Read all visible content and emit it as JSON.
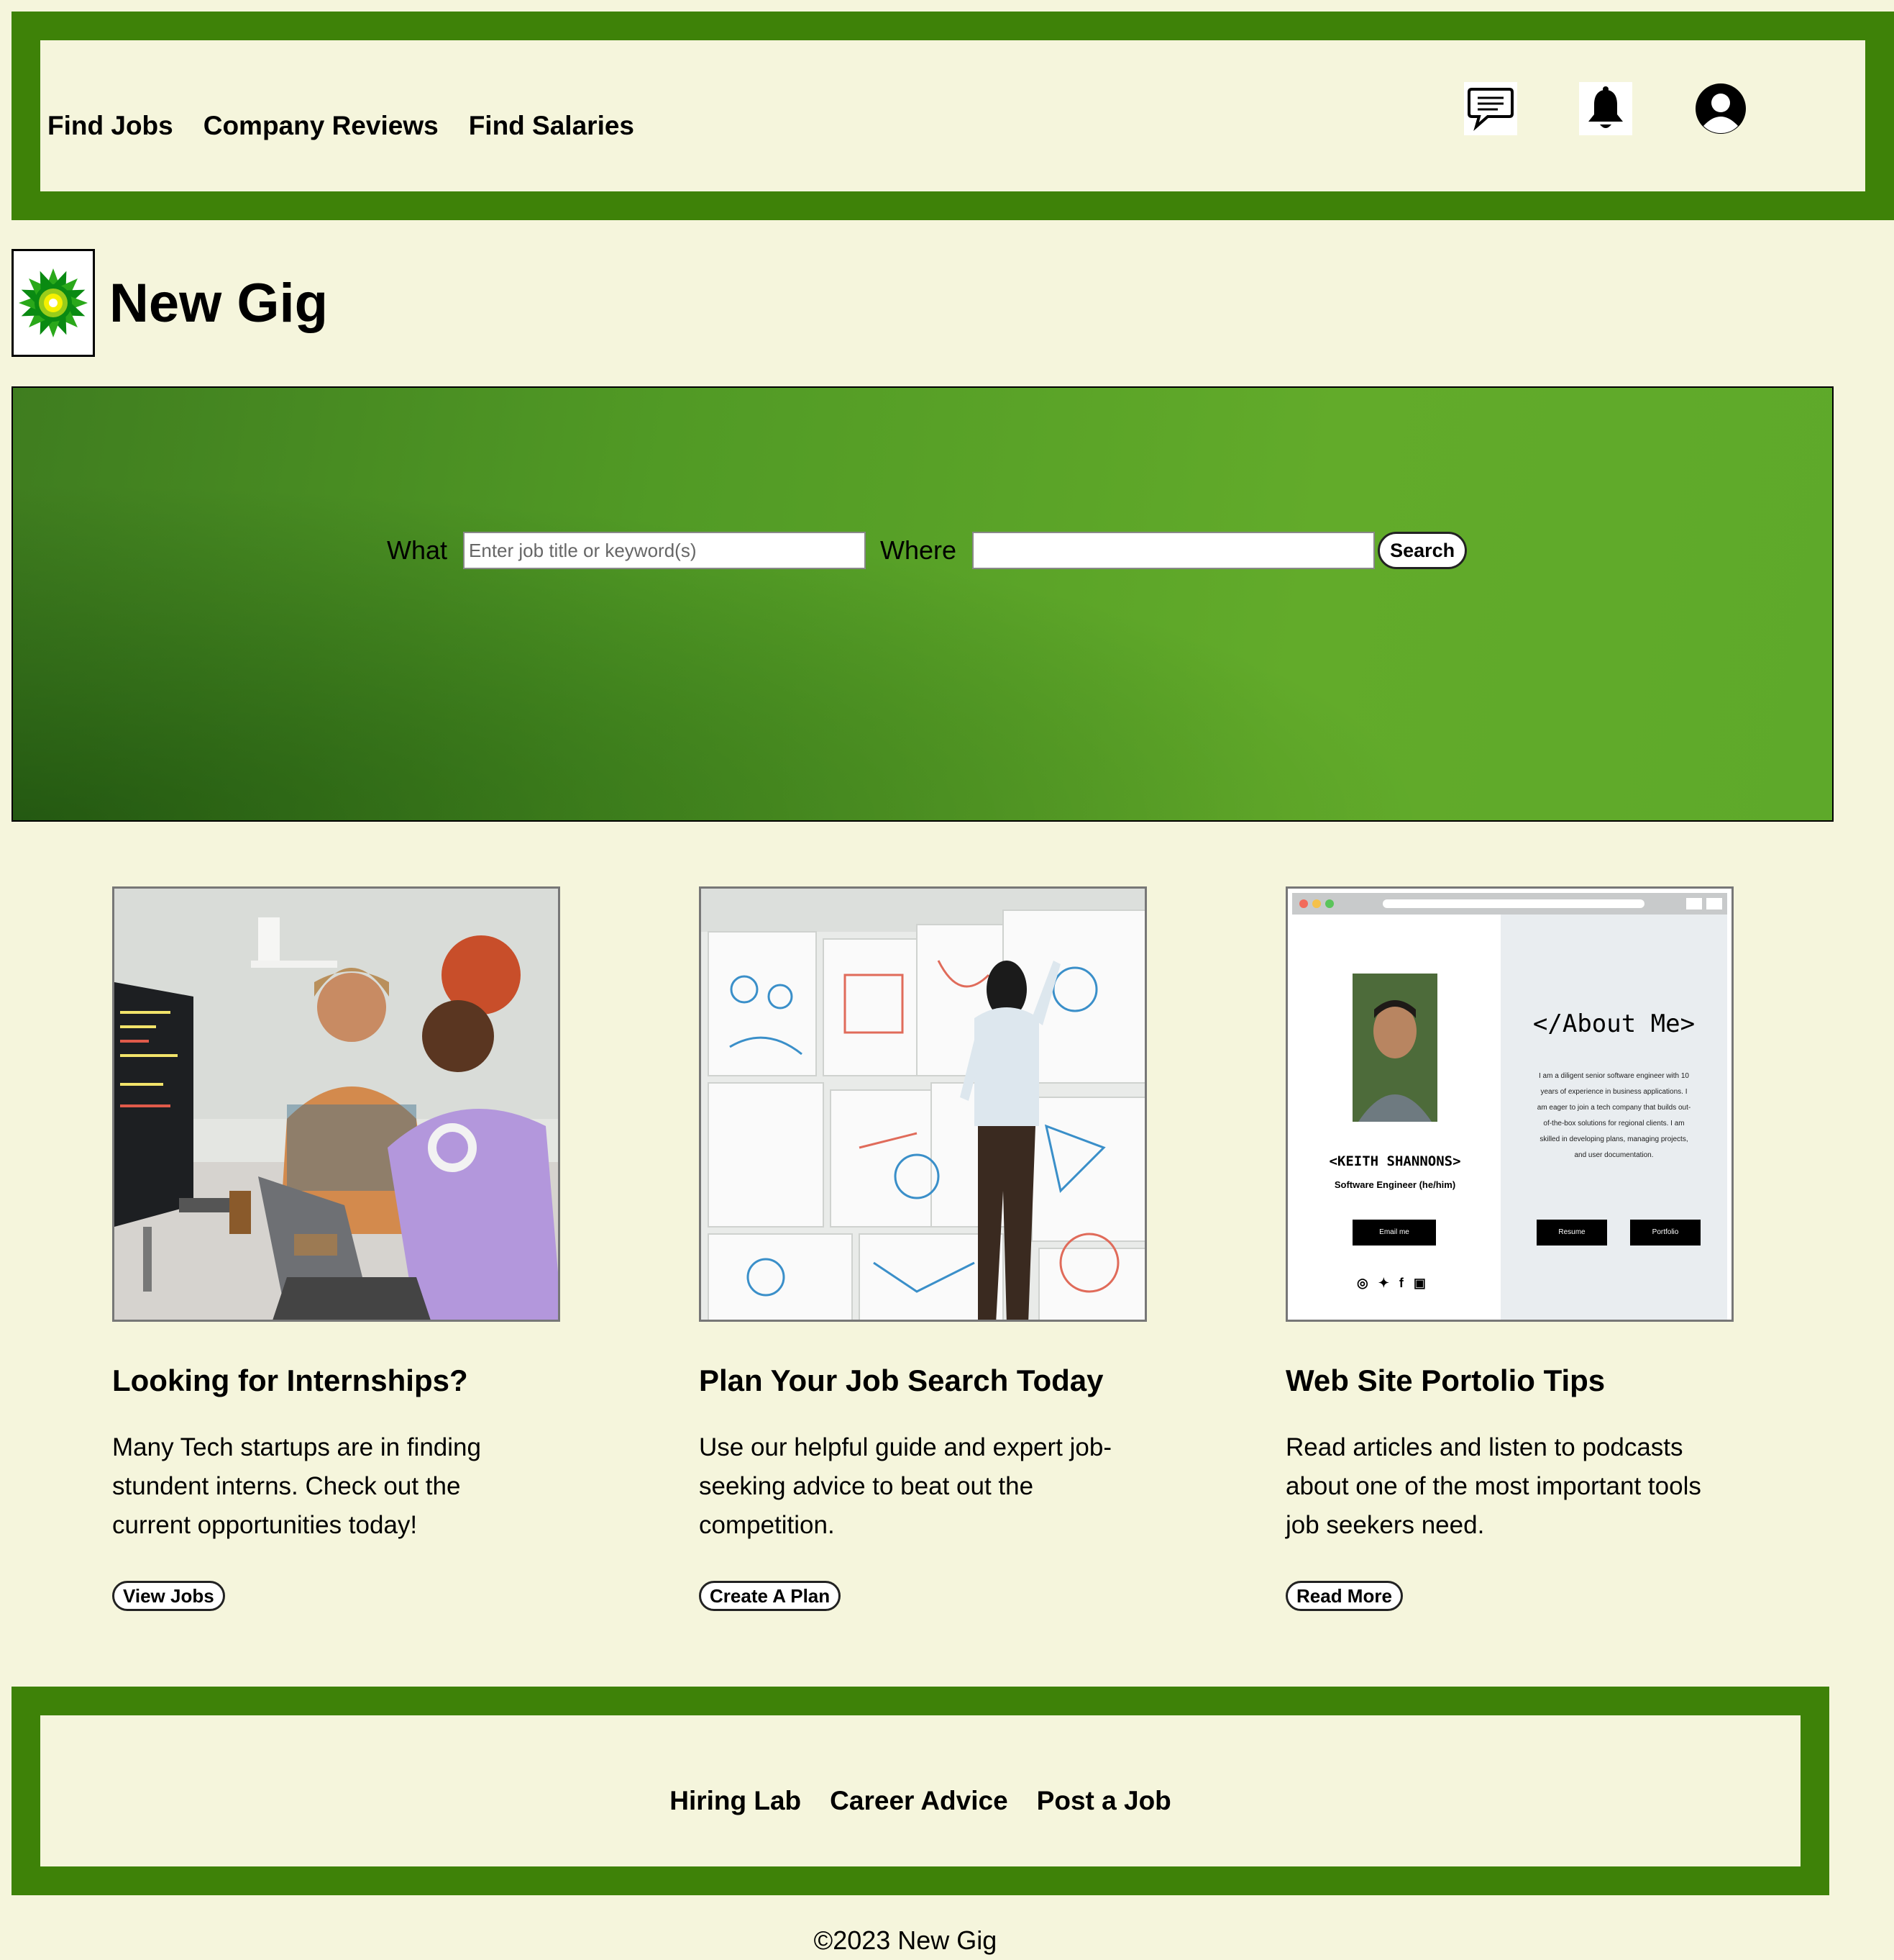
{
  "header": {
    "nav": [
      "Find Jobs",
      "Company Reviews",
      "Find Salaries"
    ],
    "icons": [
      "chat-icon",
      "bell-icon",
      "user-icon"
    ]
  },
  "brand": {
    "name": "New Gig",
    "logo": "sunflower-logo"
  },
  "search": {
    "what_label": "What",
    "what_placeholder": "Enter job title or keyword(s)",
    "what_value": "",
    "where_label": "Where",
    "where_placeholder": "",
    "where_value": "",
    "button": "Search"
  },
  "cards": [
    {
      "title": "Looking for Internships?",
      "text": "Many Tech startups are in finding stundent interns. Check out the current opportunities today!",
      "button": "View Jobs"
    },
    {
      "title": "Plan Your Job Search Today",
      "text": "Use our helpful guide and expert job-seeking advice to beat out the competition.",
      "button": "Create A Plan"
    },
    {
      "title": "Web Site Portolio Tips",
      "text": "Read articles and listen to podcasts about one of the most important tools job seekers need.",
      "button": "Read More",
      "mock": {
        "about_heading": "</About Me>",
        "about_text": "I am a diligent senior software engineer with 10 years of experience in business applications. I am eager to join a tech company that builds out-of-the-box solutions for regional clients. I am skilled in developing plans, managing projects, and user documentation.",
        "name": "<KEITH SHANNONS>",
        "role": "Software Engineer (he/him)",
        "email_btn": "Email me",
        "resume_btn": "Resume",
        "portfolio_btn": "Portfolio"
      }
    }
  ],
  "footer": {
    "nav": [
      "Hiring Lab",
      "Career Advice",
      "Post a Job"
    ],
    "copyright": "©2023 New Gig"
  },
  "colors": {
    "background": "#f5f5dc",
    "brand_green": "#3e8208",
    "hero_green": "#5ea92a"
  }
}
